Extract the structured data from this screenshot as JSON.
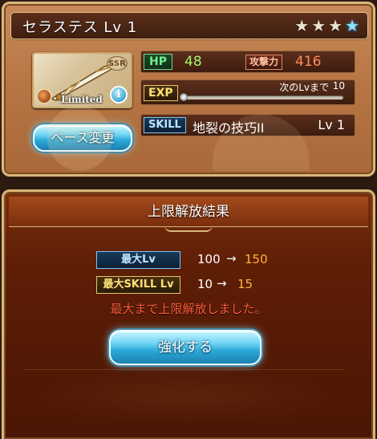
{
  "card": {
    "title": "セラステス Lv 1",
    "stars": [
      "filled",
      "filled",
      "filled",
      "special"
    ],
    "thumb_badge": "SSR",
    "thumb_label": "Limited",
    "base_change_label": "ベース変更",
    "hp_tag": "HP",
    "hp_value": "48",
    "atk_tag": "攻撃力",
    "atk_value": "416",
    "exp_tag": "EXP",
    "next_lv_label": "次のLvまで",
    "next_lv_value": "10",
    "exp_progress": 0,
    "skill_tag": "SKILL",
    "skill_name": "地裂の技巧II",
    "skill_lv": "Lv 1"
  },
  "result": {
    "title": "上限解放結果",
    "max_lv_tag": "最大Lv",
    "max_lv_from": "100",
    "max_lv_to": "150",
    "max_skill_tag": "最大SKILL Lv",
    "max_skill_from": "10",
    "max_skill_to": "15",
    "arrow": "→",
    "message": "最大まで上限解放しました。",
    "enhance_label": "強化する"
  },
  "colors": {
    "accent_gold": "#d9b77a",
    "button_blue": "#2aa9d9",
    "value_orange": "#ffb43a",
    "message_red": "#ff5a3a"
  }
}
